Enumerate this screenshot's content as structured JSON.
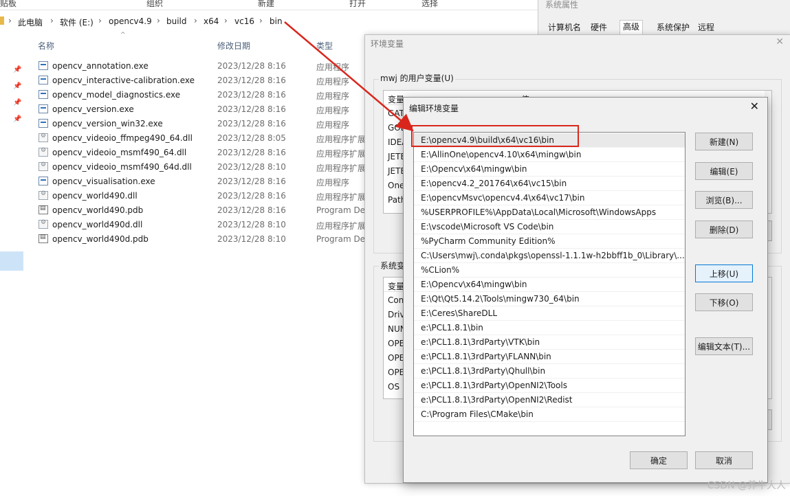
{
  "explorer": {
    "ribbon": [
      "贴板",
      "组织",
      "新建",
      "打开",
      "选择"
    ],
    "breadcrumb": [
      "此电脑",
      "软件 (E:)",
      "opencv4.9",
      "build",
      "x64",
      "vc16",
      "bin"
    ],
    "columns": {
      "name": "名称",
      "date": "修改日期",
      "type": "类型"
    },
    "files": [
      {
        "name": "opencv_annotation.exe",
        "date": "2023/12/28 8:16",
        "type": "应用程序",
        "icon": "exe-file-icon"
      },
      {
        "name": "opencv_interactive-calibration.exe",
        "date": "2023/12/28 8:16",
        "type": "应用程序",
        "icon": "exe-file-icon"
      },
      {
        "name": "opencv_model_diagnostics.exe",
        "date": "2023/12/28 8:16",
        "type": "应用程序",
        "icon": "exe-file-icon"
      },
      {
        "name": "opencv_version.exe",
        "date": "2023/12/28 8:16",
        "type": "应用程序",
        "icon": "exe-file-icon"
      },
      {
        "name": "opencv_version_win32.exe",
        "date": "2023/12/28 8:16",
        "type": "应用程序",
        "icon": "exe-file-icon"
      },
      {
        "name": "opencv_videoio_ffmpeg490_64.dll",
        "date": "2023/12/28 8:05",
        "type": "应用程序扩展",
        "icon": "dll-file-icon"
      },
      {
        "name": "opencv_videoio_msmf490_64.dll",
        "date": "2023/12/28 8:16",
        "type": "应用程序扩展",
        "icon": "dll-file-icon"
      },
      {
        "name": "opencv_videoio_msmf490_64d.dll",
        "date": "2023/12/28 8:10",
        "type": "应用程序扩展",
        "icon": "dll-file-icon"
      },
      {
        "name": "opencv_visualisation.exe",
        "date": "2023/12/28 8:16",
        "type": "应用程序",
        "icon": "exe-file-icon"
      },
      {
        "name": "opencv_world490.dll",
        "date": "2023/12/28 8:16",
        "type": "应用程序扩展",
        "icon": "dll-file-icon"
      },
      {
        "name": "opencv_world490.pdb",
        "date": "2023/12/28 8:16",
        "type": "Program De",
        "icon": "pdb-file-icon"
      },
      {
        "name": "opencv_world490d.dll",
        "date": "2023/12/28 8:10",
        "type": "应用程序扩展",
        "icon": "dll-file-icon"
      },
      {
        "name": "opencv_world490d.pdb",
        "date": "2023/12/28 8:10",
        "type": "Program De",
        "icon": "pdb-file-icon"
      }
    ]
  },
  "sysprops": {
    "title": "系统属性",
    "tabs": [
      "计算机名",
      "硬件",
      "高级",
      "系统保护",
      "远程"
    ],
    "active_tab": "高级"
  },
  "env_dialog": {
    "title": "环境变量",
    "user_group": "mwj 的用户变量(U)",
    "user_header": [
      "变量",
      "值"
    ],
    "user_vars": [
      "GAT",
      "GOL",
      "IDEA",
      "JETE",
      "JETE",
      "One",
      "Path"
    ],
    "sys_group": "系统变",
    "sys_header": [
      "变量"
    ],
    "sys_vars": [
      "Com",
      "Driv",
      "NUN",
      "OPE",
      "OPE",
      "OPE",
      "OS"
    ]
  },
  "edit_dialog": {
    "title": "编辑环境变量",
    "paths": [
      "E:\\opencv4.9\\build\\x64\\vc16\\bin",
      "E:\\AllinOne\\opencv4.10\\x64\\mingw\\bin",
      "E:\\Opencv\\x64\\mingw\\bin",
      "E:\\opencv4.2_201764\\x64\\vc15\\bin",
      "E:\\opencvMsvc\\opencv4.4\\x64\\vc17\\bin",
      "%USERPROFILE%\\AppData\\Local\\Microsoft\\WindowsApps",
      "E:\\vscode\\Microsoft VS Code\\bin",
      "%PyCharm Community Edition%",
      "C:\\Users\\mwj\\.conda\\pkgs\\openssl-1.1.1w-h2bbff1b_0\\Library\\...",
      "%CLion%",
      "E:\\Opencv\\x64\\mingw\\bin",
      "E:\\Qt\\Qt5.14.2\\Tools\\mingw730_64\\bin",
      "E:\\Ceres\\ShareDLL",
      "e:\\PCL1.8.1\\bin",
      "e:\\PCL1.8.1\\3rdParty\\VTK\\bin",
      "e:\\PCL1.8.1\\3rdParty\\FLANN\\bin",
      "e:\\PCL1.8.1\\3rdParty\\Qhull\\bin",
      "e:\\PCL1.8.1\\3rdParty\\OpenNI2\\Tools",
      "e:\\PCL1.8.1\\3rdParty\\OpenNI2\\Redist",
      "C:\\Program Files\\CMake\\bin"
    ],
    "buttons": {
      "new": "新建(N)",
      "edit": "编辑(E)",
      "browse": "浏览(B)...",
      "delete": "删除(D)",
      "move_up": "上移(U)",
      "move_down": "下移(O)",
      "edit_text": "编辑文本(T)...",
      "ok": "确定",
      "cancel": "取消"
    }
  },
  "watermark": "CSDN @养牛大人",
  "colors": {
    "highlight_box": "#d9261c",
    "focus_border": "#0078d7"
  }
}
